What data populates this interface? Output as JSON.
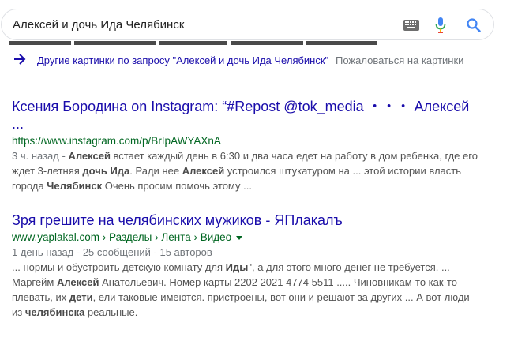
{
  "search": {
    "query": "Алексей и дочь Ида Челябинск"
  },
  "images": {
    "more_link": "Другие картинки по запросу \"Алексей и дочь Ида Челябинск\"",
    "complain": "Пожаловаться на картинки"
  },
  "results": [
    {
      "title_line1": "Ксения Бородина on Instagram: “#Repost @tok_media ・・・ Алексей",
      "title_line2": "...",
      "url": "https://www.instagram.com/p/BrIpAWYAXnA",
      "date": "3 ч. назад - ",
      "snippet": [
        [
          [
            "",
            "Алексей"
          ],
          [
            " встает каждый день в 6:30 и два часа едет на работу в дом ребенка, где его",
            ""
          ]
        ],
        [
          [
            "ждет 3-летняя ",
            ""
          ],
          [
            "дочь Ида",
            "b"
          ],
          [
            ". Ради нее ",
            ""
          ],
          [
            "Алексей",
            "b"
          ],
          [
            " устроился штукатуром на ... этой истории власть",
            ""
          ]
        ],
        [
          [
            "города ",
            ""
          ],
          [
            "Челябинск",
            "b"
          ],
          [
            " Очень просим помочь этому ...",
            ""
          ]
        ]
      ]
    },
    {
      "title": "Зря грешите на челябинских мужиков - ЯПлакалъ",
      "url": "www.yaplakal.com › Разделы › Лента › Видео",
      "meta": "1 день назад - 25 сообщений - 15 авторов",
      "snippet": [
        [
          [
            "... нормы и обустроить детскую комнату для ",
            ""
          ],
          [
            "Иды",
            "b"
          ],
          [
            "\", а для этого много денег не требуется. ...",
            ""
          ]
        ],
        [
          [
            "Маргейм ",
            ""
          ],
          [
            "Алексей",
            "b"
          ],
          [
            " Анатольевич. Номер карты 2202 2021 4774 5511 ..... Чиновникам-то как-то",
            ""
          ]
        ],
        [
          [
            "плевать, их ",
            ""
          ],
          [
            "дети",
            "b"
          ],
          [
            ", ели таковые имеются. пристроены, вот они и решают за других ... А вот люди",
            ""
          ]
        ],
        [
          [
            "из ",
            ""
          ],
          [
            "челябинска",
            "b"
          ],
          [
            " реальные.",
            ""
          ]
        ]
      ]
    }
  ],
  "colors": {
    "link": "#1a0dab",
    "url": "#006621",
    "snippet": "#545454",
    "mic_blue": "#4285f4",
    "mic_red": "#ea4335"
  },
  "icons": [
    "keyboard-icon",
    "microphone-icon",
    "search-icon",
    "arrow-right-icon",
    "caret-down-icon"
  ]
}
